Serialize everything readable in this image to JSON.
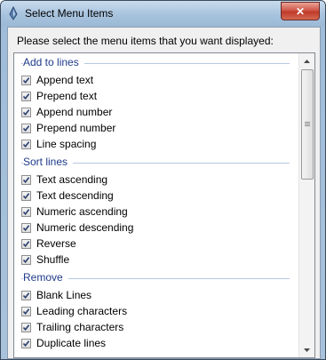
{
  "window": {
    "title": "Select Menu Items",
    "close_label": "✕"
  },
  "prompt": "Please select the menu items that you want displayed:",
  "groups": [
    {
      "title": "Add to lines",
      "items": [
        {
          "label": "Append text",
          "checked": true
        },
        {
          "label": "Prepend text",
          "checked": true
        },
        {
          "label": "Append number",
          "checked": true
        },
        {
          "label": "Prepend number",
          "checked": true
        },
        {
          "label": "Line spacing",
          "checked": true
        }
      ]
    },
    {
      "title": "Sort lines",
      "items": [
        {
          "label": "Text ascending",
          "checked": true
        },
        {
          "label": "Text descending",
          "checked": true
        },
        {
          "label": "Numeric ascending",
          "checked": true
        },
        {
          "label": "Numeric descending",
          "checked": true
        },
        {
          "label": "Reverse",
          "checked": true
        },
        {
          "label": "Shuffle",
          "checked": true
        }
      ]
    },
    {
      "title": "Remove",
      "items": [
        {
          "label": "Blank Lines",
          "checked": true
        },
        {
          "label": "Leading characters",
          "checked": true
        },
        {
          "label": "Trailing characters",
          "checked": true
        },
        {
          "label": "Duplicate lines",
          "checked": true
        }
      ]
    }
  ],
  "scrollbar": {
    "up_icon": "scroll-up-arrow",
    "down_icon": "scroll-down-arrow"
  }
}
